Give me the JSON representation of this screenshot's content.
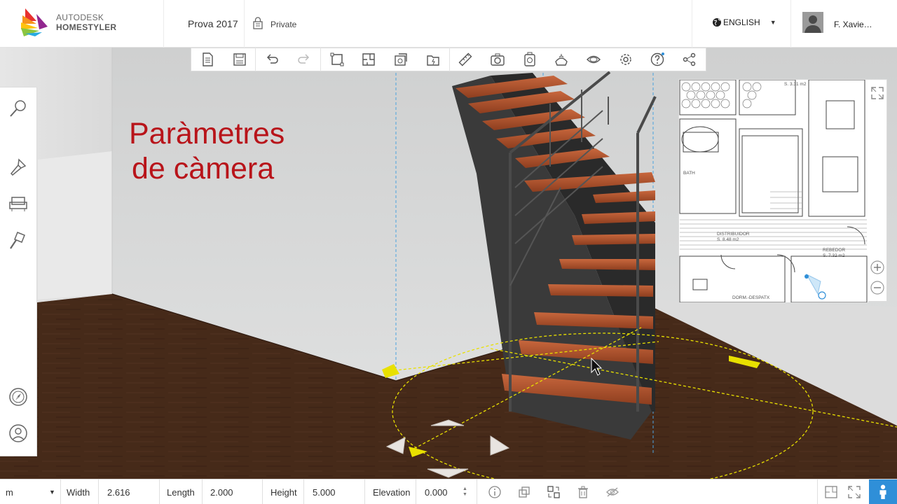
{
  "app": {
    "logo_line1": "AUTODESK",
    "logo_line2": "HOMESTYLER",
    "project_name": "Prova 2017",
    "privacy": "Private",
    "language": "ENGLISH",
    "user_name": "F. Xavie…"
  },
  "toolbar": {
    "items": [
      "new-file-icon",
      "save-icon",
      "undo-icon",
      "redo-icon",
      "draw-room-icon",
      "floorplan-icon",
      "import-icon",
      "open-folder-icon",
      "measure-icon",
      "camera-snapshot-icon",
      "render-icon",
      "material-icon",
      "view-icon",
      "settings-icon",
      "help-icon",
      "share-icon"
    ]
  },
  "left_panel": {
    "items": [
      "search-icon",
      "paint-icon",
      "furniture-icon",
      "build-tool-icon",
      "compass-icon",
      "support-icon"
    ]
  },
  "overlay": {
    "line1": "Paràmetres",
    "line2": "de càmera"
  },
  "minimap": {
    "labels": [
      "S. 3.31 m2",
      "BATH",
      "DISTRIBUIDOR",
      "S. 8.48 m2",
      "REBEDOR",
      "S. 7.32 m2",
      "DORM.-DESPATX"
    ]
  },
  "properties": {
    "unit": "m",
    "width_label": "Width",
    "width_value": "2.616",
    "length_label": "Length",
    "length_value": "2.000",
    "height_label": "Height",
    "height_value": "5.000",
    "elevation_label": "Elevation",
    "elevation_value": "0.000"
  },
  "colors": {
    "accent_blue": "#2f8fd8",
    "title_red": "#b8141a",
    "floor_brown": "#4a2e1f",
    "gizmo_yellow": "#e8e000"
  }
}
